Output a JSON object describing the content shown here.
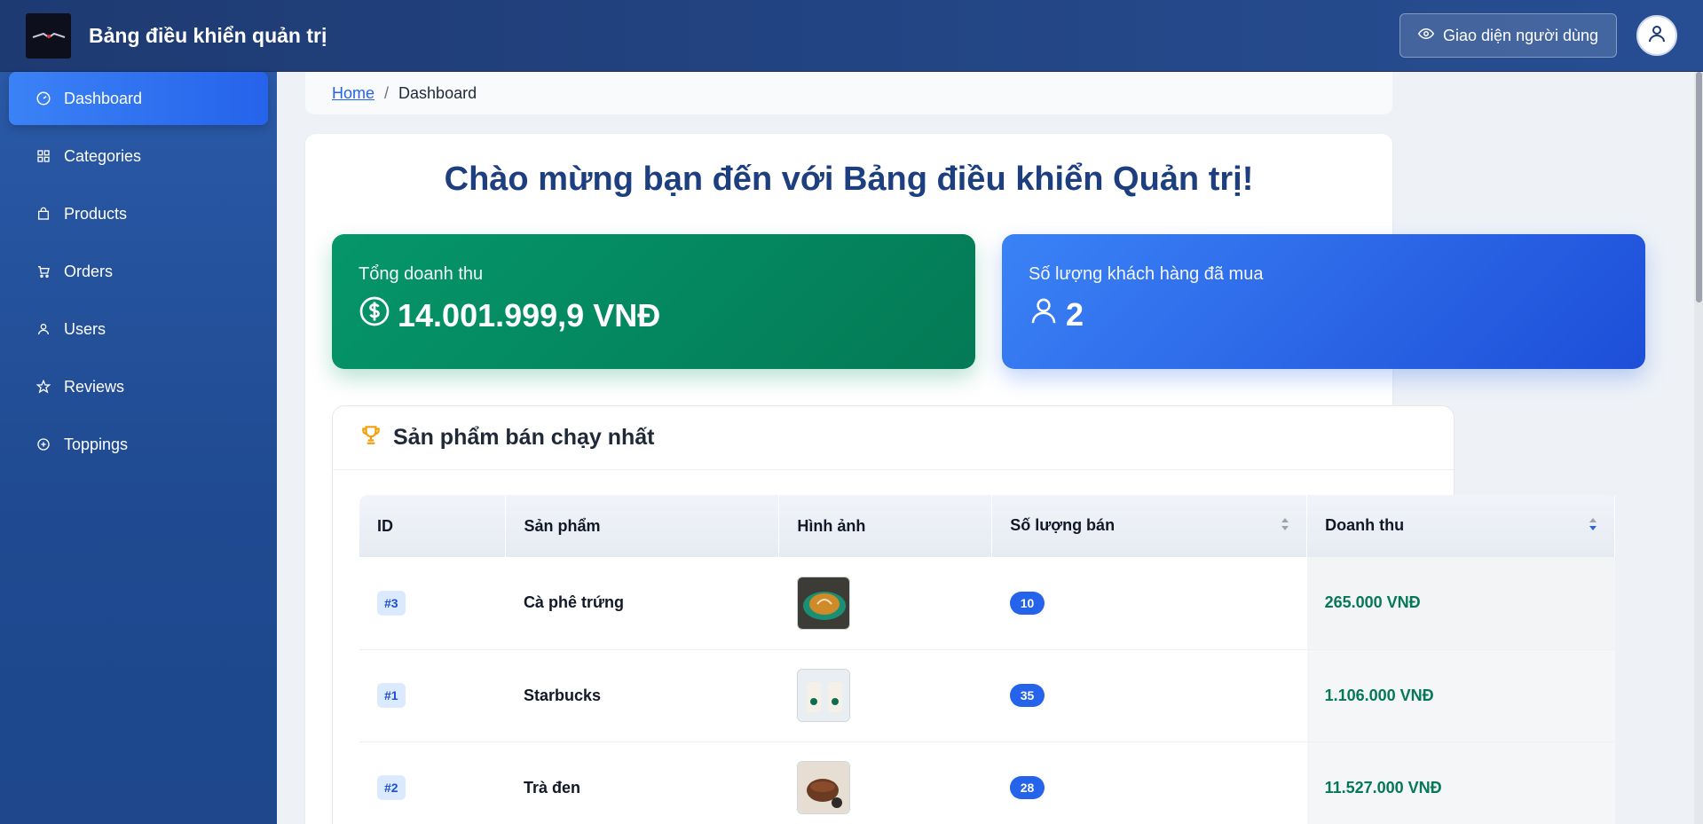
{
  "header": {
    "title": "Bảng điều khiển quản trị",
    "user_view_label": "Giao diện người dùng"
  },
  "sidebar": {
    "items": [
      {
        "label": "Dashboard",
        "icon": "gauge-icon",
        "active": true
      },
      {
        "label": "Categories",
        "icon": "grid-icon",
        "active": false
      },
      {
        "label": "Products",
        "icon": "bag-icon",
        "active": false
      },
      {
        "label": "Orders",
        "icon": "cart-icon",
        "active": false
      },
      {
        "label": "Users",
        "icon": "user-icon",
        "active": false
      },
      {
        "label": "Reviews",
        "icon": "star-icon",
        "active": false
      },
      {
        "label": "Toppings",
        "icon": "plus-circle-icon",
        "active": false
      }
    ]
  },
  "breadcrumb": {
    "home": "Home",
    "current": "Dashboard"
  },
  "main": {
    "welcome": "Chào mừng bạn đến với Bảng điều khiển Quản trị!",
    "stats": [
      {
        "label": "Tổng doanh thu",
        "value": "14.001.999,9 VNĐ",
        "icon": "dollar-icon",
        "color": "#059669"
      },
      {
        "label": "Số lượng khách hàng đã mua",
        "value": "2",
        "icon": "user-icon",
        "color": "#2563eb"
      }
    ],
    "top_products": {
      "title": "Sản phẩm bán chạy nhất",
      "columns": [
        "ID",
        "Sản phẩm",
        "Hình ảnh",
        "Số lượng bán",
        "Doanh thu"
      ],
      "rows": [
        {
          "id": "#3",
          "name": "Cà phê trứng",
          "image": "coffee-image",
          "qty": "10",
          "revenue": "265.000 VNĐ"
        },
        {
          "id": "#1",
          "name": "Starbucks",
          "image": "starbucks-image",
          "qty": "35",
          "revenue": "1.106.000 VNĐ"
        },
        {
          "id": "#2",
          "name": "Trà đen",
          "image": "tea-image",
          "qty": "28",
          "revenue": "11.527.000 VNĐ"
        }
      ]
    }
  },
  "colors": {
    "header": "#1e3a72",
    "sidebar": "#2a59a6",
    "accent": "#2563eb",
    "revenue_green": "#047857"
  }
}
